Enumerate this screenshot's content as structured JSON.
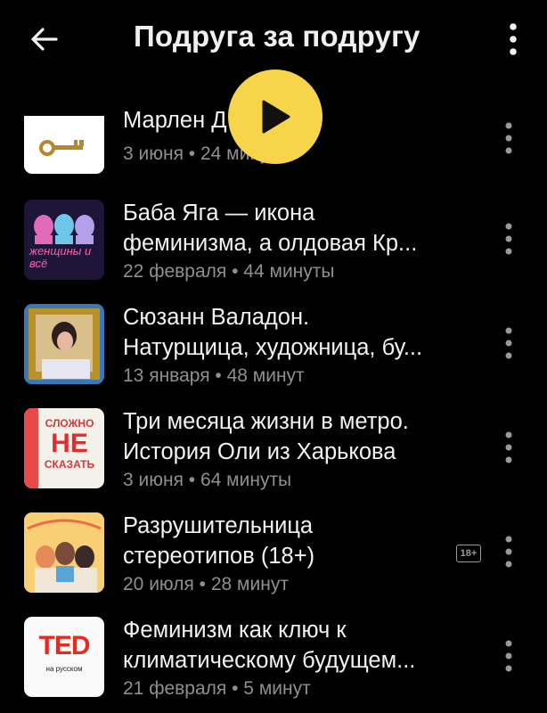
{
  "header": {
    "title": "Подруга за подругу",
    "back_icon": "arrow-left-icon",
    "menu_icon": "more-vertical-icon"
  },
  "episodes": [
    {
      "title_lines": [
        "Марлен Д",
        ""
      ],
      "meta": "3 июня • 24 минуты",
      "cover": "key"
    },
    {
      "title_lines": [
        "Баба Яга — икона",
        "феминизма, а олдовая Кр..."
      ],
      "meta": "22 февраля • 44 минуты",
      "cover": "women",
      "cover_text": "женщины и всё"
    },
    {
      "title_lines": [
        "Сюзанн Валадон.",
        "Натурщица, художница, бу..."
      ],
      "meta": "13 января • 48 минут",
      "cover": "portrait"
    },
    {
      "title_lines": [
        "Три месяца жизни в метро.",
        "История Оли из Харькова"
      ],
      "meta": "3 июня • 64 минуты",
      "cover": "slozhno",
      "cover_text": [
        "СЛОЖНО",
        "НЕ",
        "СКАЗАТЬ"
      ]
    },
    {
      "title_lines": [
        "Разрушительница",
        "стереотипов (18+)"
      ],
      "meta": "20 июля • 28 минут",
      "cover": "girlpower",
      "badge": "18+"
    },
    {
      "title_lines": [
        "Феминизм как ключ к",
        "климатическому будущем..."
      ],
      "meta": "21 февраля • 5 минут",
      "cover": "ted",
      "cover_text": [
        "TED",
        "на русском"
      ]
    }
  ],
  "play_button": {
    "icon": "play-icon",
    "color": "#f7d54a"
  },
  "colors": {
    "background": "#000000",
    "meta": "#8f8f8f",
    "accent": "#f7d54a",
    "ted_red": "#e62b1e"
  }
}
